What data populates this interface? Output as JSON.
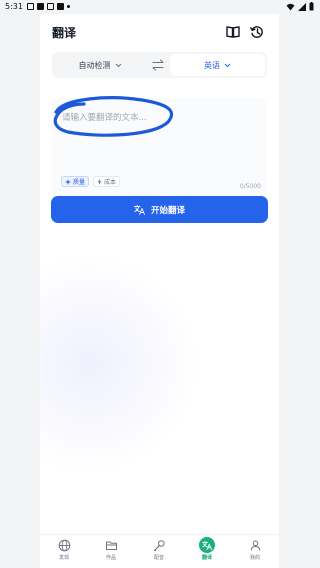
{
  "status_bar": {
    "time": "5:31"
  },
  "header": {
    "title": "翻译"
  },
  "languages": {
    "source": "自动检测",
    "target": "英语"
  },
  "input": {
    "placeholder": "请输入要翻译的文本...",
    "value": "",
    "counter": "0/5000"
  },
  "modes": [
    {
      "label": "质量",
      "active": true
    },
    {
      "label": "成本",
      "active": false
    }
  ],
  "translate_button": {
    "label": "开始翻译"
  },
  "nav": [
    {
      "label": "发现",
      "icon": "globe-icon"
    },
    {
      "label": "作品",
      "icon": "folder-icon"
    },
    {
      "label": "配音",
      "icon": "microphone-icon"
    },
    {
      "label": "翻译",
      "icon": "translate-icon",
      "active": true
    },
    {
      "label": "我的",
      "icon": "person-icon"
    }
  ],
  "colors": {
    "accent": "#2563eb",
    "nav_active": "#18b07d",
    "annotation": "#1e5ad6"
  }
}
